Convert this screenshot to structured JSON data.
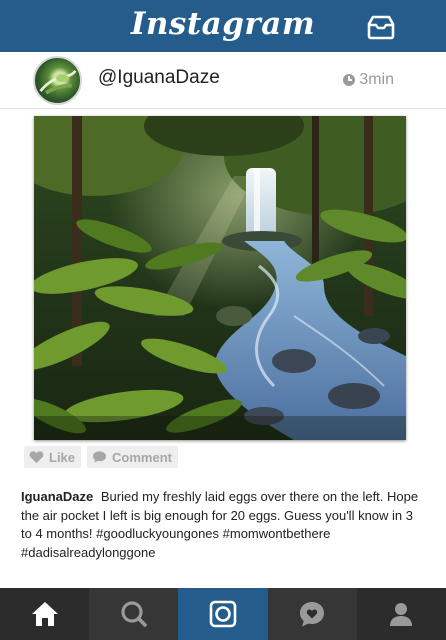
{
  "app": {
    "brand": "Instagram"
  },
  "header": {
    "inbox_icon": "inbox-tray-icon"
  },
  "post": {
    "username": "@IguanaDaze",
    "time": "3min",
    "photo_subject": "waterfall-in-rainforest-photo",
    "actions": {
      "like_label": "Like",
      "comment_label": "Comment"
    },
    "caption": {
      "author": "IguanaDaze",
      "text": "Buried my freshly laid eggs over there on the left. Hope the air pocket I left is big enough for 20 eggs. Guess you'll know in 3 to 4 months! #goodluckyoungones #momwontbethere #dadisalreadylonggone"
    }
  },
  "nav": {
    "items": [
      {
        "icon": "home-icon",
        "active": false
      },
      {
        "icon": "search-icon",
        "active": false
      },
      {
        "icon": "camera-icon",
        "active": true
      },
      {
        "icon": "activity-heart-icon",
        "active": false
      },
      {
        "icon": "profile-icon",
        "active": false
      }
    ]
  },
  "colors": {
    "brand_blue": "#245c8c",
    "nav_dark": "#2c2c2c",
    "muted_text": "#9a9a9a"
  }
}
